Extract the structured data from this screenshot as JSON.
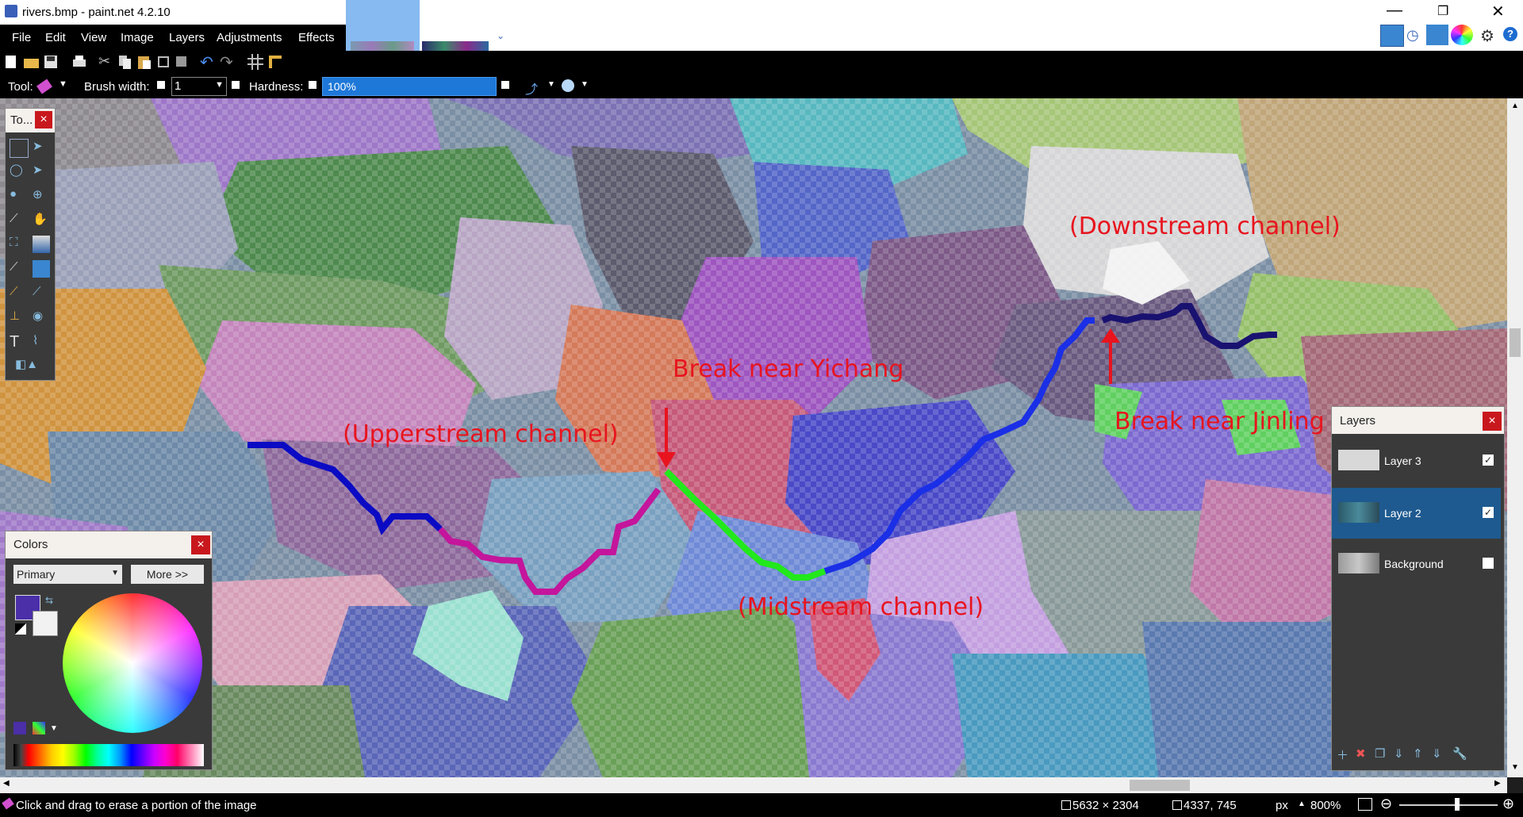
{
  "window": {
    "title": "rivers.bmp - paint.net 4.2.10",
    "controls": [
      "minimize",
      "restore",
      "close"
    ]
  },
  "menu": [
    "File",
    "Edit",
    "View",
    "Image",
    "Layers",
    "Adjustments",
    "Effects"
  ],
  "toolbar": {
    "tool_label": "Tool:",
    "brush_width_label": "Brush width:",
    "brush_width_value": "1",
    "hardness_label": "Hardness:",
    "hardness_value": "100%"
  },
  "tools_panel": {
    "title": "To..."
  },
  "colors_panel": {
    "title": "Colors",
    "mode": "Primary",
    "more_button": "More >>",
    "primary_color": "#4a2fa8",
    "secondary_color": "#f2f2f2"
  },
  "layers_panel": {
    "title": "Layers",
    "layers": [
      {
        "name": "Layer 3",
        "visible": true,
        "selected": false
      },
      {
        "name": "Layer 2",
        "visible": true,
        "selected": true
      },
      {
        "name": "Background",
        "visible": false,
        "selected": false
      }
    ]
  },
  "annotations": {
    "downstream": "(Downstream channel)",
    "break_yichang": "Break near Yichang",
    "upperstream": "(Upperstream channel)",
    "break_jinling": "Break near Jinling",
    "midstream": "(Midstream channel)"
  },
  "river_colors": {
    "upper": "#0b0bc4",
    "upper_mid": "#c4159c",
    "mid": "#22e81c",
    "lower": "#1a2fe6",
    "lower_light": "#1e6cf0",
    "downstream": "#1a1270"
  },
  "status": {
    "hint": "Click and drag to erase a portion of the image",
    "image_size": "5632 × 2304",
    "cursor_pos": "4337, 745",
    "units": "px",
    "zoom": "800%"
  }
}
